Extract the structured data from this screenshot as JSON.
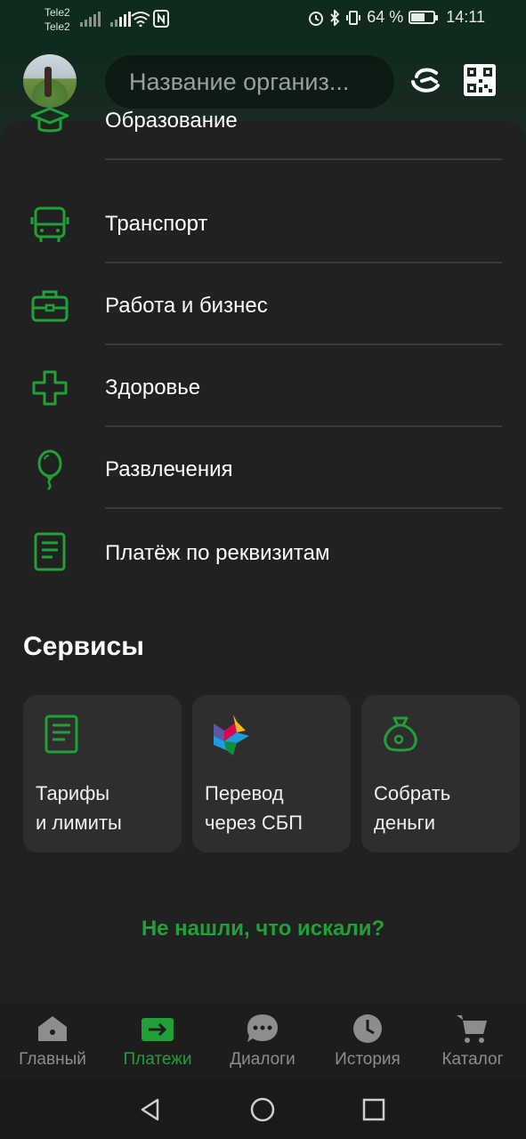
{
  "status_bar": {
    "carrier1": "Tele2",
    "carrier2": "Tele2",
    "battery_percent": "64 %",
    "battery_level": 0.64,
    "time": "14:11"
  },
  "header": {
    "search_placeholder": "Название организ..."
  },
  "categories": [
    {
      "label": "Образование",
      "icon": "graduation-cap-icon"
    },
    {
      "label": "Транспорт",
      "icon": "bus-icon"
    },
    {
      "label": "Работа и бизнес",
      "icon": "briefcase-icon"
    },
    {
      "label": "Здоровье",
      "icon": "medical-cross-icon"
    },
    {
      "label": "Развлечения",
      "icon": "balloon-icon"
    },
    {
      "label": "Платёж по реквизитам",
      "icon": "document-icon"
    }
  ],
  "services": {
    "title": "Сервисы",
    "tiles": [
      {
        "line1": "Тарифы",
        "line2": "и лимиты",
        "icon": "document-icon"
      },
      {
        "line1": "Перевод",
        "line2": "через СБП",
        "icon": "sbp-logo-icon"
      },
      {
        "line1": "Собрать",
        "line2": "деньги",
        "icon": "money-bag-icon"
      }
    ]
  },
  "not_found_link": "Не нашли, что искали?",
  "bottom_nav": [
    {
      "label": "Главный",
      "icon": "home-icon",
      "active": false
    },
    {
      "label": "Платежи",
      "icon": "payments-arrow-icon",
      "active": true
    },
    {
      "label": "Диалоги",
      "icon": "chat-bubble-icon",
      "active": false
    },
    {
      "label": "История",
      "icon": "clock-icon",
      "active": false
    },
    {
      "label": "Каталог",
      "icon": "cart-icon",
      "active": false
    }
  ],
  "colors": {
    "accent": "#21a038",
    "background": "#212121",
    "tile": "#2e2e2e",
    "inactive_nav": "#8d8d8d"
  }
}
